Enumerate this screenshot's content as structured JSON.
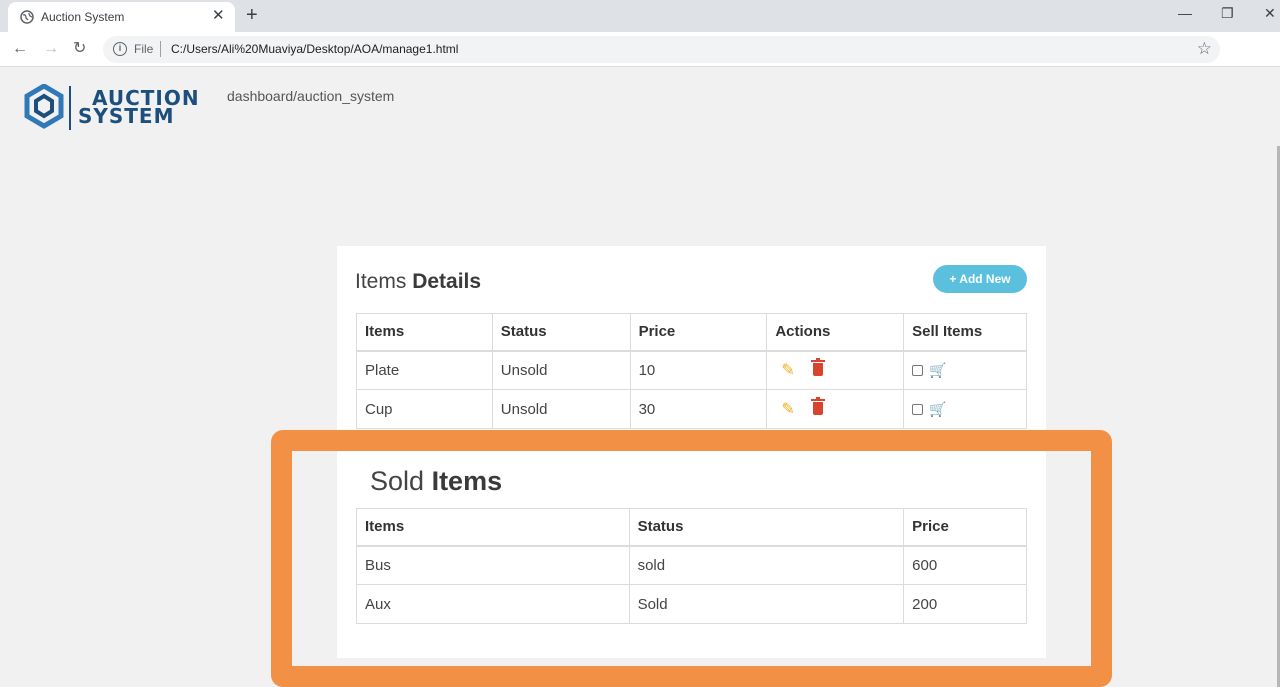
{
  "browser": {
    "tab_title": "Auction System",
    "tab_close": "✕",
    "new_tab": "+",
    "scheme": "File",
    "url": "C:/Users/Ali%20Muaviya/Desktop/AOA/manage1.html"
  },
  "header": {
    "logo_line1": "AUCTION",
    "logo_line2": "SYSTEM",
    "breadcrumb": "dashboard/auction_system"
  },
  "items_section": {
    "title_light": "Items",
    "title_bold": "Details",
    "add_button": "+ Add New",
    "columns": [
      "Items",
      "Status",
      "Price",
      "Actions",
      "Sell Items"
    ],
    "rows": [
      {
        "item": "Plate",
        "status": "Unsold",
        "price": "10"
      },
      {
        "item": "Cup",
        "status": "Unsold",
        "price": "30"
      }
    ]
  },
  "sold_section": {
    "title_light": "Sold",
    "title_bold": "Items",
    "columns": [
      "Items",
      "Status",
      "Price"
    ],
    "rows": [
      {
        "item": "Bus",
        "status": "sold",
        "price": "600"
      },
      {
        "item": "Aux",
        "status": "Sold",
        "price": "200"
      }
    ]
  },
  "colors": {
    "highlight_border": "#f29046",
    "add_button": "#5bc0de",
    "edit_icon": "#f0ad1d",
    "delete_icon": "#d9442e",
    "cart_icon": "#0d7a6e",
    "logo": "#1c4f7e"
  },
  "icons": [
    "globe-icon",
    "back-icon",
    "forward-icon",
    "reload-icon",
    "info-icon",
    "star-icon",
    "pencil-icon",
    "trash-icon",
    "cart-icon",
    "plus-icon"
  ]
}
